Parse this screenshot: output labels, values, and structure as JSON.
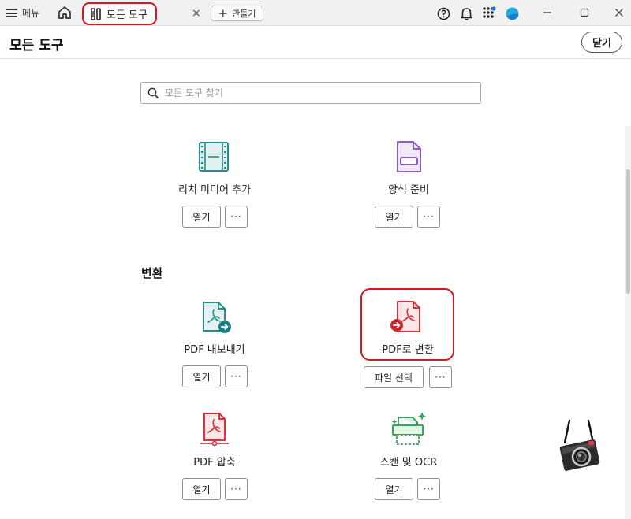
{
  "titlebar": {
    "menu_label": "메뉴",
    "tab_label": "모든 도구",
    "tab_close": "×",
    "create_label": "만들기"
  },
  "header": {
    "title": "모든 도구",
    "close_label": "닫기"
  },
  "search": {
    "placeholder": "모든 도구 찾기"
  },
  "section": {
    "convert_title": "변환"
  },
  "tools": [
    {
      "label": "리치 미디어 추가",
      "open": "열기",
      "more": "···"
    },
    {
      "label": "양식 준비",
      "open": "열기",
      "more": "···"
    },
    {
      "label": "PDF 내보내기",
      "open": "열기",
      "more": "···"
    },
    {
      "label": "PDF로 변환",
      "action": "파일 선택",
      "more": "···"
    },
    {
      "label": "PDF 압축",
      "open": "열기",
      "more": "···"
    },
    {
      "label": "스캔 및 OCR",
      "open": "열기",
      "more": "···"
    }
  ],
  "colors": {
    "highlight": "#d9161c",
    "teal": "#2a8c8c",
    "purple": "#8b5fbf",
    "pdf_red": "#d9343a",
    "green": "#3aa655"
  }
}
